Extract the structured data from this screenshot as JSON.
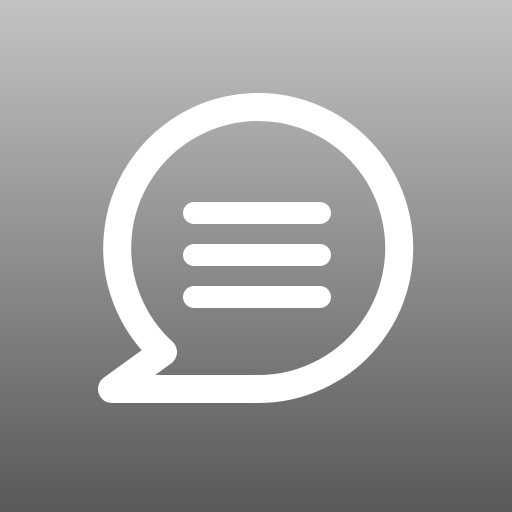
{
  "icon": {
    "glyph": "chat-bubble-lines-icon",
    "background_top_color": "#c3c3c3",
    "background_bottom_color": "#595959",
    "glyph_color": "#ffffff"
  }
}
